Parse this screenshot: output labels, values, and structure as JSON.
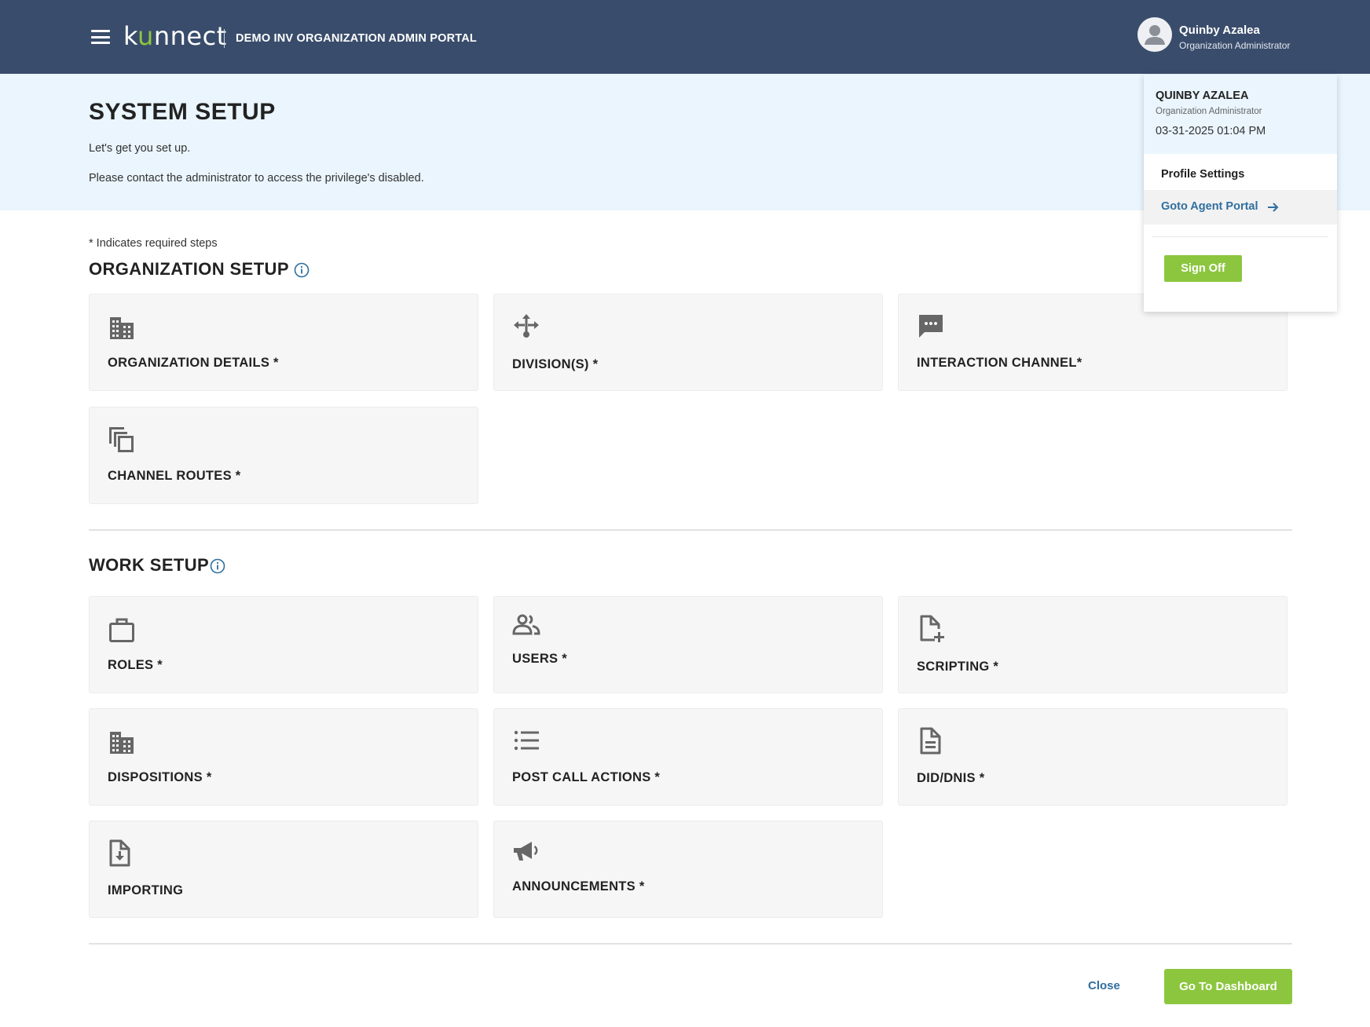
{
  "header": {
    "logo_text": "kunnect",
    "portal_title": "DEMO INV ORGANIZATION ADMIN PORTAL",
    "user_name": "Quinby Azalea",
    "user_role": "Organization Administrator",
    "background_color": "#394c6b",
    "accent_color": "#8dc63f"
  },
  "hero": {
    "title": "SYSTEM SETUP",
    "subtitle": "Let's get you set up.",
    "notice": "Please contact the administrator to access the privilege's disabled."
  },
  "required_note": "* Indicates required steps",
  "organization_setup": {
    "title": "ORGANIZATION SETUP",
    "cards": [
      {
        "label": "ORGANIZATION DETAILS *",
        "icon": "building-icon"
      },
      {
        "label": "DIVISION(S) *",
        "icon": "split-arrows-icon"
      },
      {
        "label": "INTERACTION CHANNEL*",
        "icon": "chat-bubble-icon"
      },
      {
        "label": "CHANNEL ROUTES *",
        "icon": "copy-stack-icon"
      }
    ]
  },
  "work_setup": {
    "title": "WORK SETUP",
    "cards": [
      {
        "label": "ROLES *",
        "icon": "briefcase-icon"
      },
      {
        "label": "USERS *",
        "icon": "users-icon"
      },
      {
        "label": "SCRIPTING *",
        "icon": "file-add-icon"
      },
      {
        "label": "DISPOSITIONS *",
        "icon": "building-icon"
      },
      {
        "label": "POST CALL ACTIONS *",
        "icon": "list-icon"
      },
      {
        "label": "DID/DNIS *",
        "icon": "document-icon"
      },
      {
        "label": "IMPORTING",
        "icon": "file-download-icon"
      },
      {
        "label": "ANNOUNCEMENTS *",
        "icon": "megaphone-icon"
      }
    ]
  },
  "footer": {
    "close_label": "Close",
    "dashboard_label": "Go To Dashboard"
  },
  "user_menu": {
    "name": "QUINBY AZALEA",
    "role": "Organization Administrator",
    "datetime": "03-31-2025 01:04 PM",
    "profile_settings": "Profile Settings",
    "agent_portal": "Goto Agent Portal",
    "sign_off": "Sign Off"
  }
}
